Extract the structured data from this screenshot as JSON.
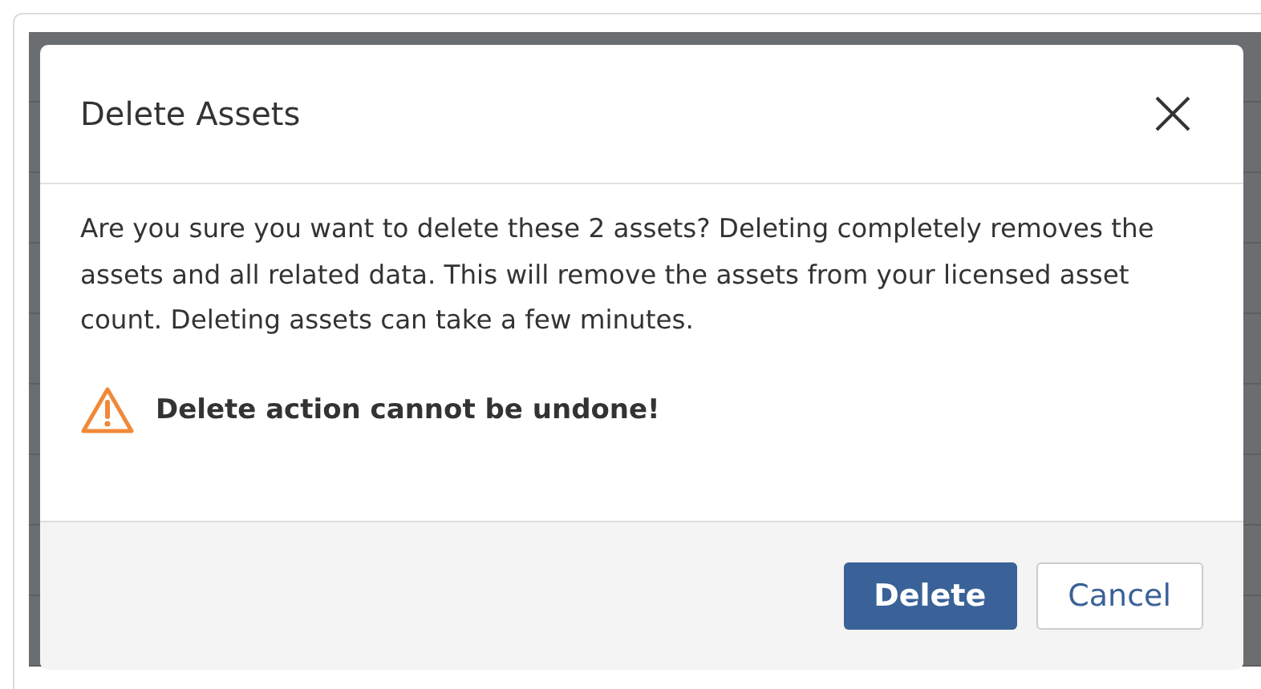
{
  "dialog": {
    "title": "Delete Assets",
    "message": "Are you sure you want to delete these 2 assets? Deleting completely removes the assets and all related data. This will remove the assets from your licensed asset count. Deleting assets can take a few minutes.",
    "warning": "Delete action cannot be undone!",
    "buttons": [
      {
        "label": "Delete",
        "kind": "primary"
      },
      {
        "label": "Cancel",
        "kind": "secondary"
      }
    ]
  }
}
